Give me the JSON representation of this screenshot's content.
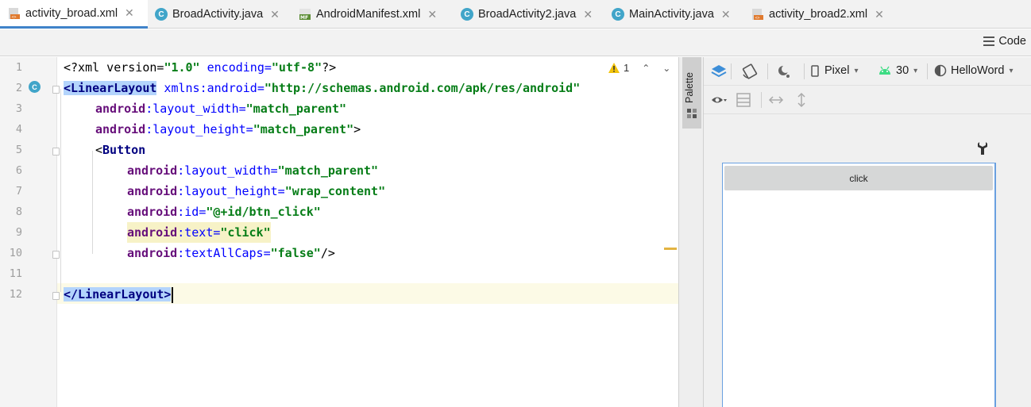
{
  "tabs": [
    {
      "label": "activity_broad.xml",
      "icon": "xml-layout-icon",
      "active": true
    },
    {
      "label": "BroadActivity.java",
      "icon": "class-icon",
      "active": false
    },
    {
      "label": "AndroidManifest.xml",
      "icon": "manifest-icon",
      "active": false
    },
    {
      "label": "BroadActivity2.java",
      "icon": "class-icon",
      "active": false
    },
    {
      "label": "MainActivity.java",
      "icon": "class-icon",
      "active": false
    },
    {
      "label": "activity_broad2.xml",
      "icon": "xml-layout-icon",
      "active": false
    }
  ],
  "tab_close_glyph": "✕",
  "class_icon_letter": "C",
  "manifest_icon_text": "MF",
  "view_mode": {
    "code_label": "Code"
  },
  "editor": {
    "line_numbers": [
      "1",
      "2",
      "3",
      "4",
      "5",
      "6",
      "7",
      "8",
      "9",
      "10",
      "11",
      "12"
    ],
    "current_line": "12",
    "inspection": {
      "warning_count": "1",
      "prev_glyph": "⌃",
      "next_glyph": "⌄"
    },
    "lines": [
      {
        "l1": "<?xml version=",
        "l2": "\"1.0\"",
        "l3": " encoding=",
        "l4": "\"utf-8\"",
        "l5": "?>"
      },
      {
        "tag": "<LinearLayout",
        "attr": " xmlns:android=",
        "val": "\"http://schemas.android.com/apk/res/android\""
      },
      {
        "ns": "android",
        "colon": ":",
        "attr": "layout_width",
        "eq": "=",
        "val": "\"match_parent\""
      },
      {
        "ns": "android",
        "colon": ":",
        "attr": "layout_height",
        "eq": "=",
        "val": "\"match_parent\"",
        "end": ">"
      },
      {
        "open": "<",
        "tag": "Button"
      },
      {
        "ns": "android",
        "colon": ":",
        "attr": "layout_width",
        "eq": "=",
        "val": "\"match_parent\""
      },
      {
        "ns": "android",
        "colon": ":",
        "attr": "layout_height",
        "eq": "=",
        "val": "\"wrap_content\""
      },
      {
        "ns": "android",
        "colon": ":",
        "attr": "id",
        "eq": "=",
        "val": "\"@+id/btn_click\""
      },
      {
        "ns": "android",
        "colon": ":",
        "attr": "text",
        "eq": "=",
        "val": "\"click\""
      },
      {
        "ns": "android",
        "colon": ":",
        "attr": "textAllCaps",
        "eq": "=",
        "val": "\"false\"",
        "end": "/>"
      },
      {},
      {
        "tag": "</LinearLayout>"
      }
    ]
  },
  "palette": {
    "label": "Palette"
  },
  "design_toolbar": {
    "device": "Pixel",
    "api_level": "30",
    "theme": "HelloWord",
    "dropdown_glyph": "▾"
  },
  "preview": {
    "button_text": "click"
  },
  "colors": {
    "accent": "#4083c9",
    "tag_highlight": "#b3d4fc",
    "string": "#067d17",
    "keyword": "#000080",
    "namespace": "#660e7a"
  }
}
